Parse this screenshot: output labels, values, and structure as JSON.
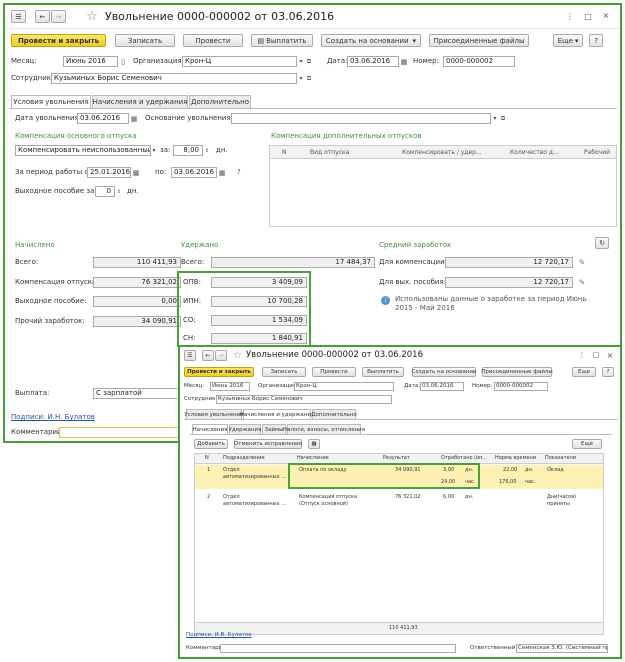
{
  "main": {
    "title": "Увольнение 0000-000002 от 03.06.2016",
    "toolbar": {
      "post_close": "Провести и закрыть",
      "save": "Записать",
      "post": "Провести",
      "pay": "Выплатить",
      "create_base": "Создать на основании",
      "attached_files": "Присоединенные файлы",
      "more": "Еще",
      "help": "?"
    },
    "fields": {
      "month_label": "Месяц:",
      "month_value": "Июнь 2016",
      "org_label": "Организация:",
      "org_value": "Крон-Ц",
      "date_label": "Дата:",
      "date_value": "03.06.2016",
      "number_label": "Номер:",
      "number_value": "0000-000002",
      "employee_label": "Сотрудник:",
      "employee_value": "Кузьминых Борис Семенович"
    },
    "tabs": [
      "Условия увольнения",
      "Начисления и удержания",
      "Дополнительно"
    ],
    "conditions": {
      "dismiss_date_label": "Дата увольнения:",
      "dismiss_date_value": "03.06.2016",
      "reason_label": "Основание увольнения:",
      "reason_value": "",
      "main_vacation_title": "Компенсация основного отпуска",
      "main_vacation_select": "Компенсировать неиспользованный о",
      "for_label": "за:",
      "for_value": "8,00",
      "days_label": "дн.",
      "period_label": "За период работы с:",
      "period_from": "25.01.2016",
      "period_to_label": "по:",
      "period_to": "03.06.2016",
      "help_q": "?",
      "severance_label": "Выходное пособие за:",
      "severance_value": "0",
      "severance_days": "дн.",
      "extra_vacation_title": "Компенсация дополнительных отпусков",
      "extra_cols": [
        "N",
        "Вид отпуска",
        "Компенсировать / удер...",
        "Количество д...",
        "Рабочий"
      ]
    },
    "accrued": {
      "title": "Начислено",
      "total_label": "Всего:",
      "total_value": "110 411,93",
      "comp_label": "Компенсация отпуска:",
      "comp_value": "76 321,02",
      "severance_label": "Выходное пособие:",
      "severance_value": "0,00",
      "other_label": "Прочий заработок:",
      "other_value": "34 090,91"
    },
    "withheld": {
      "title": "Удержано",
      "total_label": "Всего:",
      "total_value": "17 484,37",
      "rows": [
        {
          "label": "ОПВ:",
          "value": "3 409,09"
        },
        {
          "label": "ИПН:",
          "value": "10 700,28"
        },
        {
          "label": "СО:",
          "value": "1 534,09"
        },
        {
          "label": "СН:",
          "value": "1 840,91"
        }
      ]
    },
    "avg": {
      "title": "Средний заработок",
      "comp_label": "Для компенсации:",
      "comp_value": "12 720,17",
      "sev_label": "Для вых. пособия:",
      "sev_value": "12 720,17",
      "info": "Использованы данные о заработке за период Июнь 2015 - Май 2016"
    },
    "payment_label": "Выплата:",
    "payment_value": "С зарплатой",
    "signatures": "Подписи: И.Н. Булатов",
    "comment_label": "Комментарий:"
  },
  "second": {
    "title": "Увольнение 0000-000002 от 03.06.2016",
    "toolbar": {
      "post_close": "Провести и закрыть",
      "save": "Записать",
      "post": "Провести",
      "pay": "Выплатить",
      "create_base": "Создать на основании",
      "attached_files": "Присоединенные файлы",
      "more": "Еще",
      "help": "?"
    },
    "fields": {
      "month_label": "Месяц:",
      "month_value": "Июнь 2016",
      "org_label": "Организация:",
      "org_value": "Крон-Ц",
      "date_label": "Дата:",
      "date_value": "03.06.2016",
      "number_label": "Номер:",
      "number_value": "0000-000002",
      "employee_label": "Сотрудник:",
      "employee_value": "Кузьминых Борис Семенович"
    },
    "tabs": [
      "Условия увольнения",
      "Начисления и удержания",
      "Дополнительно"
    ],
    "subtabs": [
      "Начисления",
      "Удержания",
      "Займы",
      "Налоги, взносы, отчисления"
    ],
    "add_btn": "Добавить",
    "cancel_btn": "Отменить исправления",
    "more": "Еще",
    "columns": [
      "N",
      "Подразделение",
      "Начисление",
      "Результат",
      "Отработано (оп...",
      "Норма времени",
      "Показатели"
    ],
    "rows": [
      {
        "n": "1",
        "dept": "Отдел автоматизированных ...",
        "accrual": "Оплата по окладу",
        "result": "34 090,91",
        "worked1": "3,00",
        "unit1": "дн.",
        "worked2": "24,00",
        "unit2": "час.",
        "norm1": "22,00",
        "nunit1": "дн.",
        "norm2": "176,00",
        "nunit2": "час.",
        "ind": "Оклад"
      },
      {
        "n": "2",
        "dept": "Отдел автоматизированных ...",
        "accrual": "Компенсация отпуска (Отпуск основной)",
        "result": "76 321,02",
        "worked1": "6,00",
        "unit1": "дн.",
        "ind": "Дни(часов) приняты"
      }
    ],
    "total": "110 411,93",
    "signatures": "Подписи: И.В. Булатов",
    "comment_label": "Комментарий:",
    "resp_label": "Ответственный:",
    "resp_value": "Семенская З.Ю. (Системный про"
  }
}
